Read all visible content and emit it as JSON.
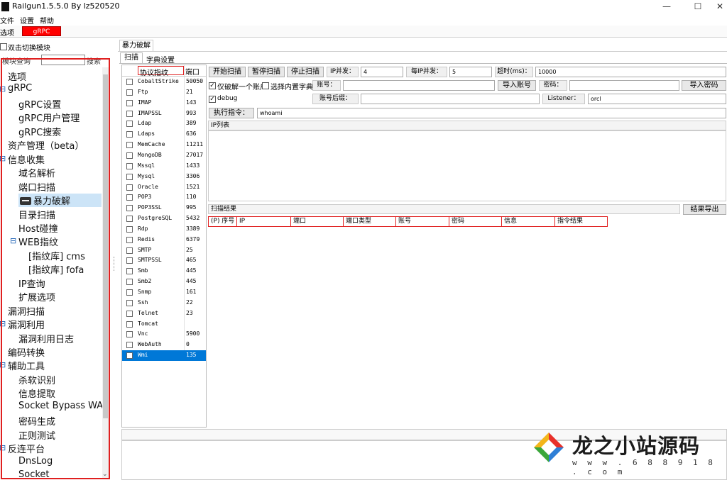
{
  "window": {
    "title": "Railgun1.5.5.0 By lz520520",
    "minimize": "—",
    "maximize": "☐",
    "close": "✕"
  },
  "menu": [
    "文件",
    "设置",
    "帮助"
  ],
  "top_tabs": {
    "options": "选项",
    "grpc": "gRPC"
  },
  "left": {
    "dblclick_label": "双击切换模块",
    "search_label": "模块查询",
    "search_value": "",
    "search_button": "搜索",
    "tree": [
      {
        "label": "选项",
        "level": 0,
        "toggle": ""
      },
      {
        "label": "gRPC",
        "level": 0,
        "toggle": "⊟"
      },
      {
        "label": "gRPC设置",
        "level": 1,
        "toggle": ""
      },
      {
        "label": "gRPC用户管理",
        "level": 1,
        "toggle": ""
      },
      {
        "label": "gRPC搜索",
        "level": 1,
        "toggle": ""
      },
      {
        "label": "资产管理（beta）",
        "level": 0,
        "toggle": ""
      },
      {
        "label": "信息收集",
        "level": 0,
        "toggle": "⊟"
      },
      {
        "label": "域名解析",
        "level": 1,
        "toggle": ""
      },
      {
        "label": "端口扫描",
        "level": 1,
        "toggle": ""
      },
      {
        "label": "暴力破解",
        "level": 1,
        "toggle": "",
        "selected": true,
        "icon": "toolbox-icon"
      },
      {
        "label": "目录扫描",
        "level": 1,
        "toggle": ""
      },
      {
        "label": "Host碰撞",
        "level": 1,
        "toggle": ""
      },
      {
        "label": "WEB指纹",
        "level": 1,
        "toggle": "⊟"
      },
      {
        "label": "[指纹库] cms",
        "level": 2,
        "toggle": ""
      },
      {
        "label": "[指纹库] fofa",
        "level": 2,
        "toggle": ""
      },
      {
        "label": "IP查询",
        "level": 1,
        "toggle": ""
      },
      {
        "label": "扩展选项",
        "level": 1,
        "toggle": ""
      },
      {
        "label": "漏洞扫描",
        "level": 0,
        "toggle": ""
      },
      {
        "label": "漏洞利用",
        "level": 0,
        "toggle": "⊟"
      },
      {
        "label": "漏洞利用日志",
        "level": 1,
        "toggle": ""
      },
      {
        "label": "编码转换",
        "level": 0,
        "toggle": ""
      },
      {
        "label": "辅助工具",
        "level": 0,
        "toggle": "⊟"
      },
      {
        "label": "杀软识别",
        "level": 1,
        "toggle": ""
      },
      {
        "label": "信息提取",
        "level": 1,
        "toggle": ""
      },
      {
        "label": "Socket Bypass WAF",
        "level": 1,
        "toggle": ""
      },
      {
        "label": "密码生成",
        "level": 1,
        "toggle": ""
      },
      {
        "label": "正则测试",
        "level": 1,
        "toggle": ""
      },
      {
        "label": "反连平台",
        "level": 0,
        "toggle": "⊟"
      },
      {
        "label": "DnsLog",
        "level": 1,
        "toggle": ""
      },
      {
        "label": "Socket",
        "level": 1,
        "toggle": ""
      }
    ]
  },
  "module_tab": "暴力破解",
  "sub_tabs": {
    "scan": "扫描",
    "dict": "字典设置"
  },
  "protocol_table": {
    "headers": {
      "name": "协议指纹",
      "port": "端口"
    },
    "rows": [
      {
        "name": "CobaltStrike",
        "port": "50050"
      },
      {
        "name": "Ftp",
        "port": "21"
      },
      {
        "name": "IMAP",
        "port": "143"
      },
      {
        "name": "IMAPSSL",
        "port": "993"
      },
      {
        "name": "Ldap",
        "port": "389"
      },
      {
        "name": "Ldaps",
        "port": "636"
      },
      {
        "name": "MemCache",
        "port": "11211"
      },
      {
        "name": "MongoDB",
        "port": "27017"
      },
      {
        "name": "Mssql",
        "port": "1433"
      },
      {
        "name": "Mysql",
        "port": "3306"
      },
      {
        "name": "Oracle",
        "port": "1521"
      },
      {
        "name": "POP3",
        "port": "110"
      },
      {
        "name": "POP3SSL",
        "port": "995"
      },
      {
        "name": "PostgreSQL",
        "port": "5432"
      },
      {
        "name": "Rdp",
        "port": "3389"
      },
      {
        "name": "Redis",
        "port": "6379"
      },
      {
        "name": "SMTP",
        "port": "25"
      },
      {
        "name": "SMTPSSL",
        "port": "465"
      },
      {
        "name": "Smb",
        "port": "445"
      },
      {
        "name": "Smb2",
        "port": "445"
      },
      {
        "name": "Snmp",
        "port": "161"
      },
      {
        "name": "Ssh",
        "port": "22"
      },
      {
        "name": "Telnet",
        "port": "23"
      },
      {
        "name": "Tomcat",
        "port": ""
      },
      {
        "name": "Vnc",
        "port": "5900"
      },
      {
        "name": "WebAuth",
        "port": "0"
      },
      {
        "name": "Wmi",
        "port": "135",
        "selected": true
      }
    ]
  },
  "controls": {
    "start_scan": "开始扫描",
    "pause_scan": "暂停扫描",
    "stop_scan": "停止扫描",
    "ip_concurrency_label": "IP并发：",
    "ip_concurrency_value": "4",
    "per_ip_concurrency_label": "每IP并发：",
    "per_ip_concurrency_value": "5",
    "timeout_label": "超时(ms)：",
    "timeout_value": "10000",
    "only_one_account": "仅破解一个账户",
    "builtin_dict": "选择内置字典",
    "account_label": "账号：",
    "account_value": "",
    "import_account": "导入账号",
    "password_label": "密码：",
    "password_value": "",
    "import_password": "导入密码",
    "debug": "debug",
    "account_suffix_label": "账号后缀：",
    "account_suffix_value": "",
    "listener_label": "Listener：",
    "listener_value": "orcl",
    "exec_cmd_button": "执行指令：",
    "exec_cmd_value": "whoami"
  },
  "ip_list": {
    "header": "IP列表"
  },
  "results": {
    "header": "扫描结果",
    "export_button": "结果导出",
    "columns": [
      "(P) 序号",
      "IP",
      "端口",
      "端口类型",
      "账号",
      "密码",
      "信息",
      "指令结果"
    ]
  },
  "watermark": {
    "title": "龙之小站源码",
    "url": "w w w . 6 8 8 9 1 8 . c o m"
  }
}
